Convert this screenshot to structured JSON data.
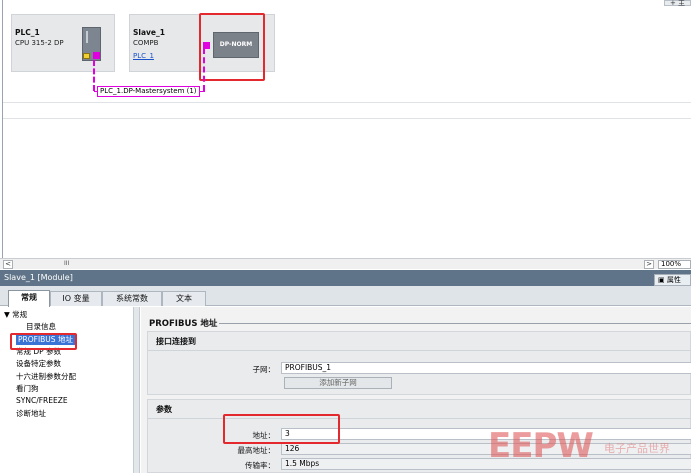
{
  "toolbar": {
    "top_right_label": "+ 主"
  },
  "network": {
    "plc": {
      "name": "PLC_1",
      "type": "CPU 315-2 DP"
    },
    "slave": {
      "name": "Slave_1",
      "type": "COMPB",
      "link": "PLC_1",
      "module_label": "DP-NORM"
    },
    "bus_label": "PLC_1.DP-Mastersystem (1)"
  },
  "scrollbar": {
    "left_arrow": "<",
    "right_arrow": ">",
    "thumb_mark": "III",
    "zoom": "100%"
  },
  "inspector": {
    "title": "Slave_1 [Module]",
    "properties_button": "属性",
    "tabs": [
      {
        "label": "常规"
      },
      {
        "label": "IO 变量"
      },
      {
        "label": "系统常数"
      },
      {
        "label": "文本"
      }
    ],
    "tree": {
      "root": "▼ 常规",
      "items": [
        {
          "label": "目录信息"
        },
        {
          "label": "PROFIBUS 地址"
        },
        {
          "label": "常规 DP 参数"
        },
        {
          "label": "设备特定参数"
        },
        {
          "label": "十六进制参数分配"
        },
        {
          "label": "看门狗"
        },
        {
          "label": "SYNC/FREEZE"
        },
        {
          "label": "诊断地址"
        }
      ]
    },
    "content": {
      "section_title": "PROFIBUS 地址",
      "interface": {
        "title": "接口连接到",
        "subnet_label": "子网：",
        "subnet_value": "PROFIBUS_1",
        "add_subnet_button": "添加新子网"
      },
      "params": {
        "title": "参数",
        "address_label": "地址：",
        "address_value": "3",
        "max_address_label": "最高地址：",
        "max_address_value": "126",
        "baud_label": "传输率：",
        "baud_value": "1.5 Mbps"
      }
    }
  },
  "watermark": {
    "brand": "EEPW",
    "tagline": "电子产品世界"
  },
  "colors": {
    "highlight_red": "#e3292e",
    "bus_magenta": "#e000e0",
    "title_bar": "#5f7488",
    "selection_blue": "#3a73d6"
  }
}
